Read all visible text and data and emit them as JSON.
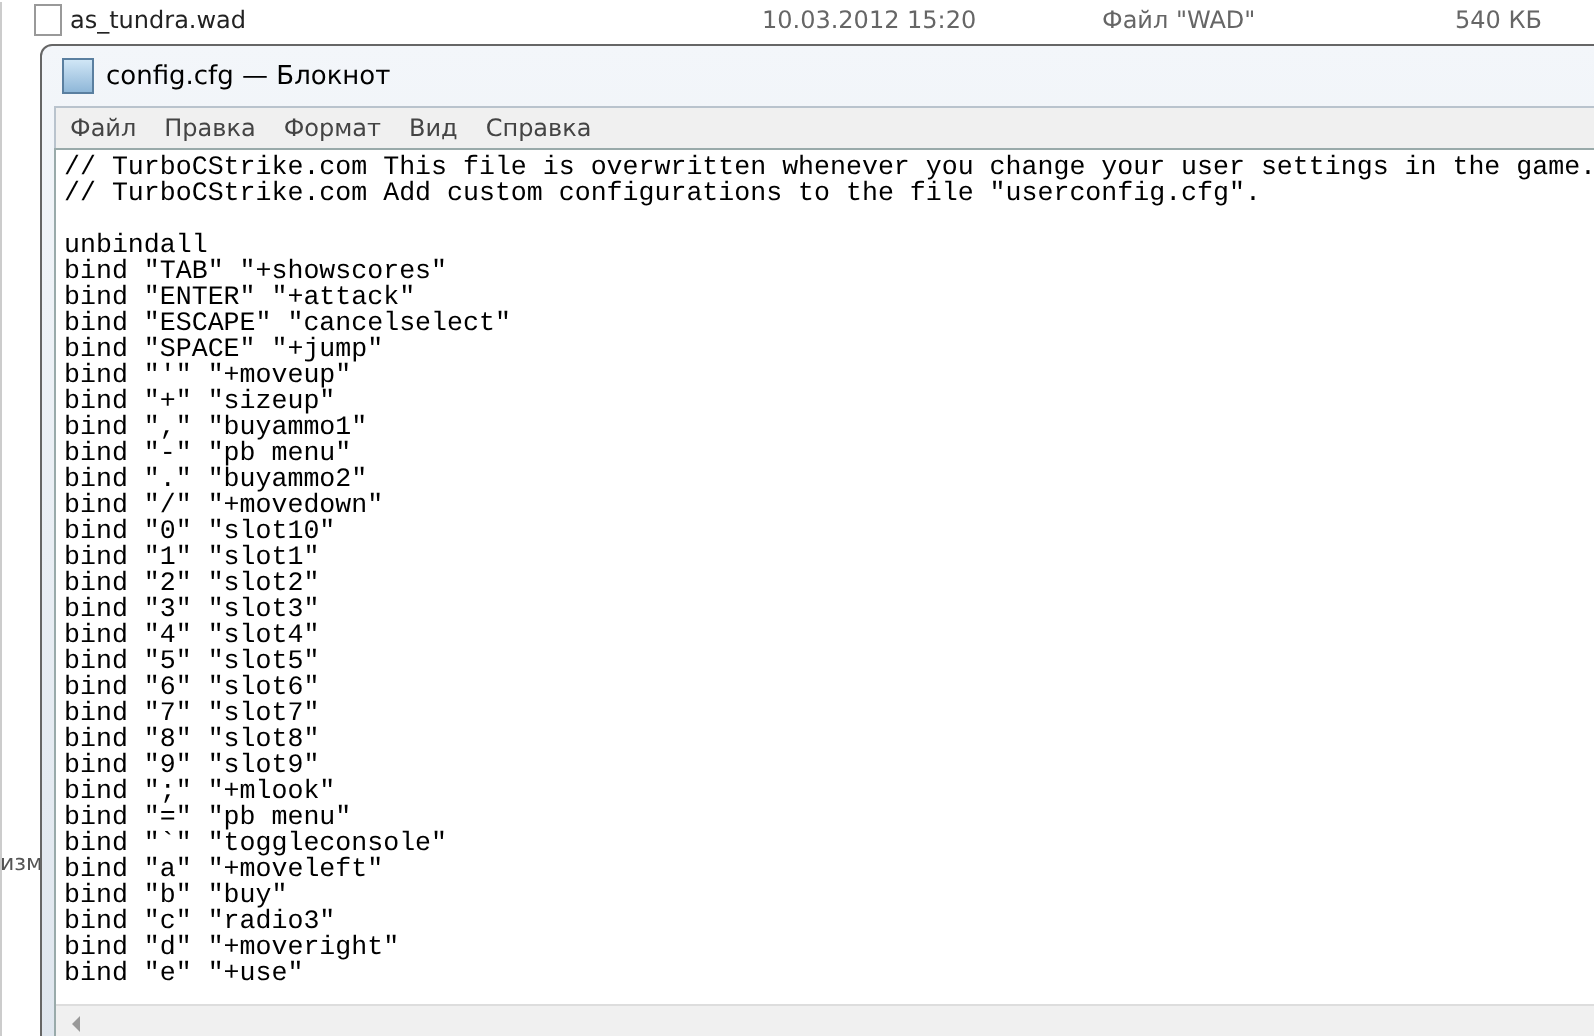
{
  "explorer": {
    "files": [
      {
        "name": "as_tundra.wad",
        "date": "10.03.2012 15:20",
        "type": "Файл \"WAD\"",
        "size": "540 КБ"
      }
    ],
    "side_label": "изм"
  },
  "notepad": {
    "title": "config.cfg — Блокнот",
    "menu": [
      "Файл",
      "Правка",
      "Формат",
      "Вид",
      "Справка"
    ],
    "header_lines": [
      "// TurboCStrike.com This file is overwritten whenever you change your user settings in the game.",
      "// TurboCStrike.com Add custom configurations to the file \"userconfig.cfg\"."
    ],
    "lines": [
      "unbindall",
      "bind \"TAB\" \"+showscores\"",
      "bind \"ENTER\" \"+attack\"",
      "bind \"ESCAPE\" \"cancelselect\"",
      "bind \"SPACE\" \"+jump\"",
      "bind \"'\" \"+moveup\"",
      "bind \"+\" \"sizeup\"",
      "bind \",\" \"buyammo1\"",
      "bind \"-\" \"pb menu\"",
      "bind \".\" \"buyammo2\"",
      "bind \"/\" \"+movedown\"",
      "bind \"0\" \"slot10\"",
      "bind \"1\" \"slot1\"",
      "bind \"2\" \"slot2\"",
      "bind \"3\" \"slot3\"",
      "bind \"4\" \"slot4\"",
      "bind \"5\" \"slot5\"",
      "bind \"6\" \"slot6\"",
      "bind \"7\" \"slot7\"",
      "bind \"8\" \"slot8\"",
      "bind \"9\" \"slot9\"",
      "bind \";\" \"+mlook\"",
      "bind \"=\" \"pb menu\"",
      "bind \"`\" \"toggleconsole\"",
      "bind \"a\" \"+moveleft\"",
      "bind \"b\" \"buy\"",
      "bind \"c\" \"radio3\"",
      "bind \"d\" \"+moveright\"",
      "bind \"e\" \"+use\""
    ]
  }
}
